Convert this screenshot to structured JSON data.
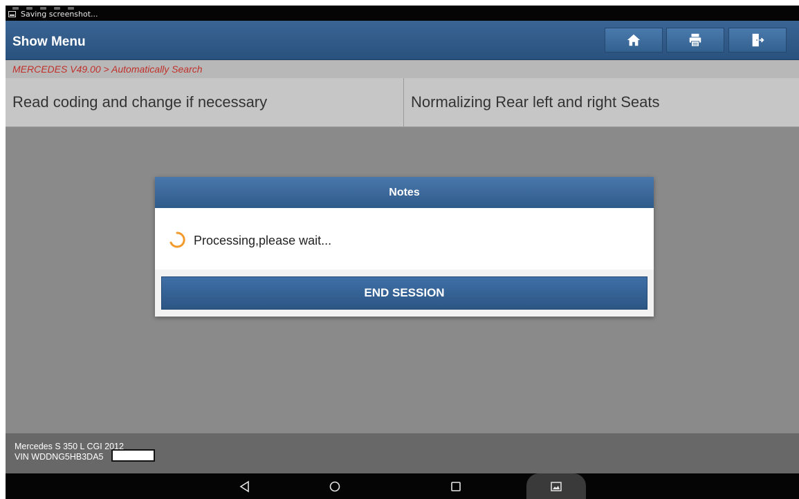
{
  "status_bar": {
    "notification_text": "Saving screenshot...",
    "notification_icon": "screenshot-icon"
  },
  "header": {
    "title": "Show Menu",
    "buttons": [
      {
        "icon": "home-icon"
      },
      {
        "icon": "print-icon"
      },
      {
        "icon": "exit-icon"
      }
    ]
  },
  "breadcrumb": "MERCEDES V49.00 > Automatically Search",
  "menu": {
    "items": [
      {
        "label": "Read coding and change if necessary"
      },
      {
        "label": "Normalizing Rear left and right Seats"
      }
    ]
  },
  "dialog": {
    "title": "Notes",
    "message": "Processing,please wait...",
    "end_button": "END SESSION",
    "spinner_color": "#f39a2c"
  },
  "vehicle": {
    "model": "Mercedes S 350 L CGI 2012",
    "vin": "VIN WDDNG5HB3DA5"
  },
  "colors": {
    "header_blue": "#2f5b8b",
    "breadcrumb_red": "#c0302a"
  }
}
